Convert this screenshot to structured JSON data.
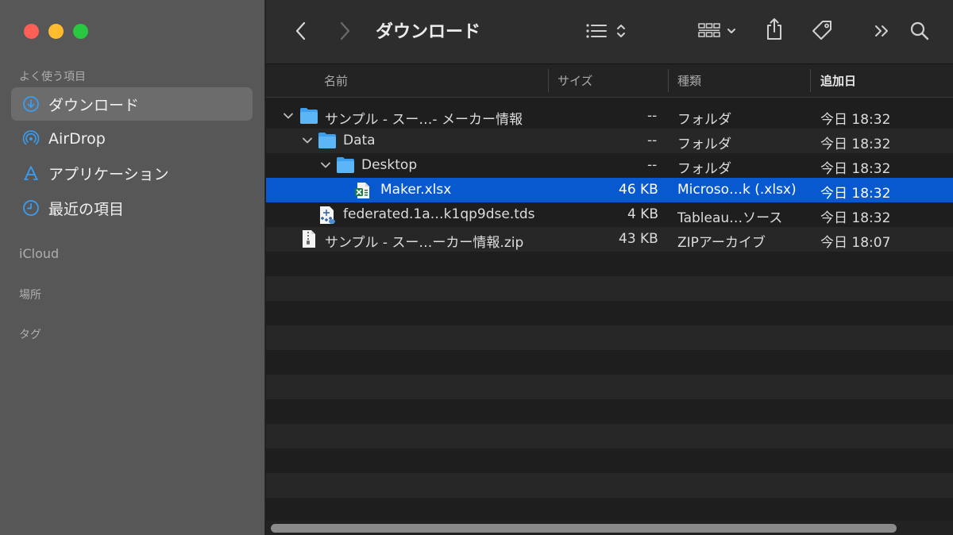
{
  "sidebar": {
    "favorites_header": "よく使う項目",
    "items": [
      {
        "label": "ダウンロード",
        "icon": "download-icon"
      },
      {
        "label": "AirDrop",
        "icon": "airdrop-icon"
      },
      {
        "label": "アプリケーション",
        "icon": "applications-icon"
      },
      {
        "label": "最近の項目",
        "icon": "recents-icon"
      }
    ],
    "icloud_header": "iCloud",
    "locations_header": "場所",
    "tags_header": "タグ"
  },
  "toolbar": {
    "title": "ダウンロード"
  },
  "columns": {
    "name": "名前",
    "size": "サイズ",
    "kind": "種類",
    "date_added": "追加日"
  },
  "files": [
    {
      "name": "サンプル - スー…- メーカー情報",
      "size": "--",
      "kind": "フォルダ",
      "date": "今日 18:32",
      "type": "folder",
      "level": 0,
      "expanded": true
    },
    {
      "name": "Data",
      "size": "--",
      "kind": "フォルダ",
      "date": "今日 18:32",
      "type": "folder",
      "level": 1,
      "expanded": true
    },
    {
      "name": "Desktop",
      "size": "--",
      "kind": "フォルダ",
      "date": "今日 18:32",
      "type": "folder",
      "level": 2,
      "expanded": true
    },
    {
      "name": "Maker.xlsx",
      "size": "46 KB",
      "kind": "Microso…k (.xlsx)",
      "date": "今日 18:32",
      "type": "xlsx",
      "level": 3,
      "selected": true
    },
    {
      "name": "federated.1a…k1qp9dse.tds",
      "size": "4 KB",
      "kind": "Tableau…ソース",
      "date": "今日 18:32",
      "type": "tds",
      "level": 1
    },
    {
      "name": "サンプル - スー…ーカー情報.zip",
      "size": "43 KB",
      "kind": "ZIPアーカイブ",
      "date": "今日 18:07",
      "type": "zip",
      "level": 0
    }
  ],
  "colors": {
    "selection": "#0859d0",
    "folder": "#3ea1f0",
    "sidebar_accent": "#3a9df2"
  }
}
